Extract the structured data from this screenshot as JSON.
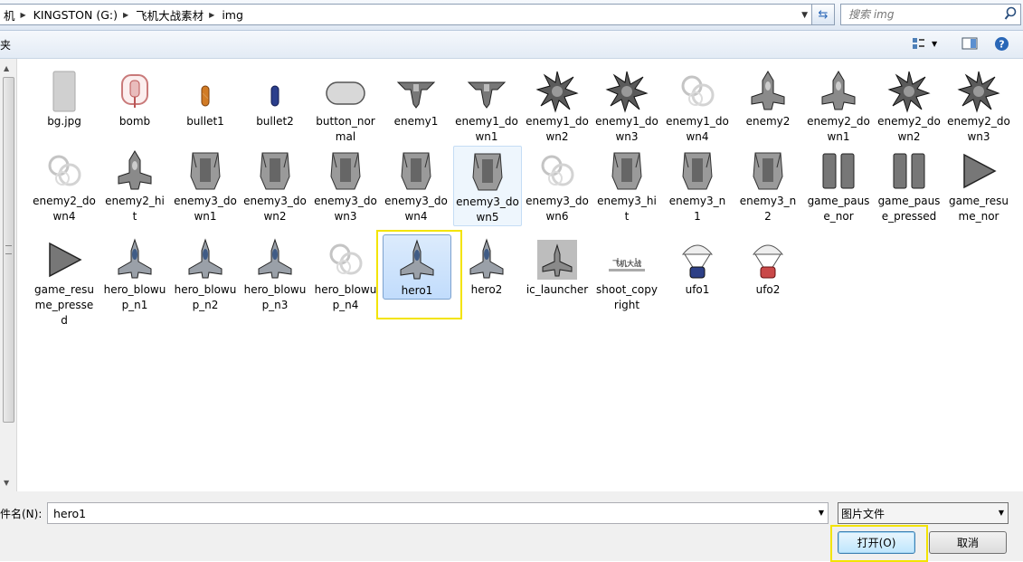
{
  "breadcrumb": [
    "机",
    "KINGSTON (G:)",
    "飞机大战素材",
    "img"
  ],
  "search": {
    "placeholder": "搜索 img"
  },
  "toolbar": {
    "left_label": "夹"
  },
  "files": [
    {
      "name": "bg.jpg",
      "icon": "bg"
    },
    {
      "name": "bomb",
      "icon": "bomb"
    },
    {
      "name": "bullet1",
      "icon": "bullet-orange"
    },
    {
      "name": "bullet2",
      "icon": "bullet-blue"
    },
    {
      "name": "button_normal",
      "icon": "button"
    },
    {
      "name": "enemy1",
      "icon": "enemy1"
    },
    {
      "name": "enemy1_down1",
      "icon": "enemy1"
    },
    {
      "name": "enemy1_down2",
      "icon": "explode"
    },
    {
      "name": "enemy1_down3",
      "icon": "explode"
    },
    {
      "name": "enemy1_down4",
      "icon": "smoke"
    },
    {
      "name": "enemy2",
      "icon": "enemy2"
    },
    {
      "name": "enemy2_down1",
      "icon": "enemy2"
    },
    {
      "name": "enemy2_down2",
      "icon": "explode"
    },
    {
      "name": "enemy2_down3",
      "icon": "explode"
    },
    {
      "name": "enemy2_down4",
      "icon": "smoke"
    },
    {
      "name": "enemy2_hit",
      "icon": "enemy2"
    },
    {
      "name": "enemy3_down1",
      "icon": "enemy3"
    },
    {
      "name": "enemy3_down2",
      "icon": "enemy3"
    },
    {
      "name": "enemy3_down3",
      "icon": "enemy3"
    },
    {
      "name": "enemy3_down4",
      "icon": "enemy3"
    },
    {
      "name": "enemy3_down5",
      "icon": "enemy3"
    },
    {
      "name": "enemy3_down6",
      "icon": "smoke"
    },
    {
      "name": "enemy3_hit",
      "icon": "enemy3"
    },
    {
      "name": "enemy3_n1",
      "icon": "enemy3"
    },
    {
      "name": "enemy3_n2",
      "icon": "enemy3"
    },
    {
      "name": "game_pause_nor",
      "icon": "pause"
    },
    {
      "name": "game_pause_pressed",
      "icon": "pause"
    },
    {
      "name": "game_resume_nor",
      "icon": "play"
    },
    {
      "name": "game_resume_pressed",
      "icon": "play"
    },
    {
      "name": "hero_blowup_n1",
      "icon": "hero"
    },
    {
      "name": "hero_blowup_n2",
      "icon": "hero"
    },
    {
      "name": "hero_blowup_n3",
      "icon": "hero"
    },
    {
      "name": "hero_blowup_n4",
      "icon": "smoke"
    },
    {
      "name": "hero1",
      "icon": "hero"
    },
    {
      "name": "hero2",
      "icon": "hero"
    },
    {
      "name": "ic_launcher",
      "icon": "launcher"
    },
    {
      "name": "shoot_copyright",
      "icon": "copyright"
    },
    {
      "name": "ufo1",
      "icon": "ufo-blue"
    },
    {
      "name": "ufo2",
      "icon": "ufo-red"
    }
  ],
  "selected_file": "hero1",
  "hovered_file": "enemy3_down5",
  "copyright_text": "飞机大战",
  "footer": {
    "filename_label": "文件名(N):",
    "filename_value": "hero1",
    "filter_value": "图片文件",
    "open_label": "打开(O)",
    "cancel_label": "取消"
  },
  "colors": {
    "selection": "#c1dcfc",
    "highlight": "#f3e400",
    "accent": "#2a67b7"
  }
}
